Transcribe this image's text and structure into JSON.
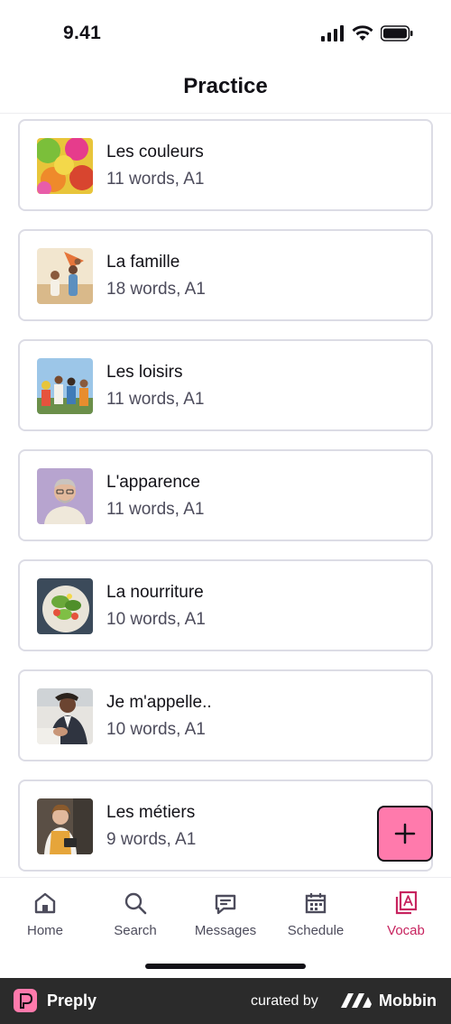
{
  "status_bar": {
    "time": "9.41"
  },
  "header": {
    "title": "Practice"
  },
  "decks": [
    {
      "title": "Les couleurs",
      "subtitle": "11 words, A1",
      "thumb_icon": "colorful-powder-photo"
    },
    {
      "title": "La famille",
      "subtitle": "18 words, A1",
      "thumb_icon": "family-beach-photo"
    },
    {
      "title": "Les loisirs",
      "subtitle": "11 words, A1",
      "thumb_icon": "friends-outdoors-photo"
    },
    {
      "title": "L'apparence",
      "subtitle": "11 words, A1",
      "thumb_icon": "man-portrait-photo"
    },
    {
      "title": "La nourriture",
      "subtitle": "10 words, A1",
      "thumb_icon": "salad-plate-photo"
    },
    {
      "title": "Je m'appelle..",
      "subtitle": "10 words, A1",
      "thumb_icon": "handshake-photo"
    },
    {
      "title": "Les métiers",
      "subtitle": "9 words, A1",
      "thumb_icon": "waitress-photo"
    }
  ],
  "fab": {
    "icon": "plus-icon"
  },
  "tabs": [
    {
      "label": "Home",
      "icon": "home-icon",
      "active": false
    },
    {
      "label": "Search",
      "icon": "search-icon",
      "active": false
    },
    {
      "label": "Messages",
      "icon": "messages-icon",
      "active": false
    },
    {
      "label": "Schedule",
      "icon": "calendar-icon",
      "active": false
    },
    {
      "label": "Vocab",
      "icon": "vocab-icon",
      "active": true
    }
  ],
  "colors": {
    "accent": "#ff7aac",
    "active_tab": "#c7245f",
    "text": "#121117",
    "muted": "#4d4c5c",
    "card_border": "#dcdce5"
  },
  "footer": {
    "brand": "Preply",
    "curated_by": "curated by",
    "mobbin": "Mobbin"
  }
}
